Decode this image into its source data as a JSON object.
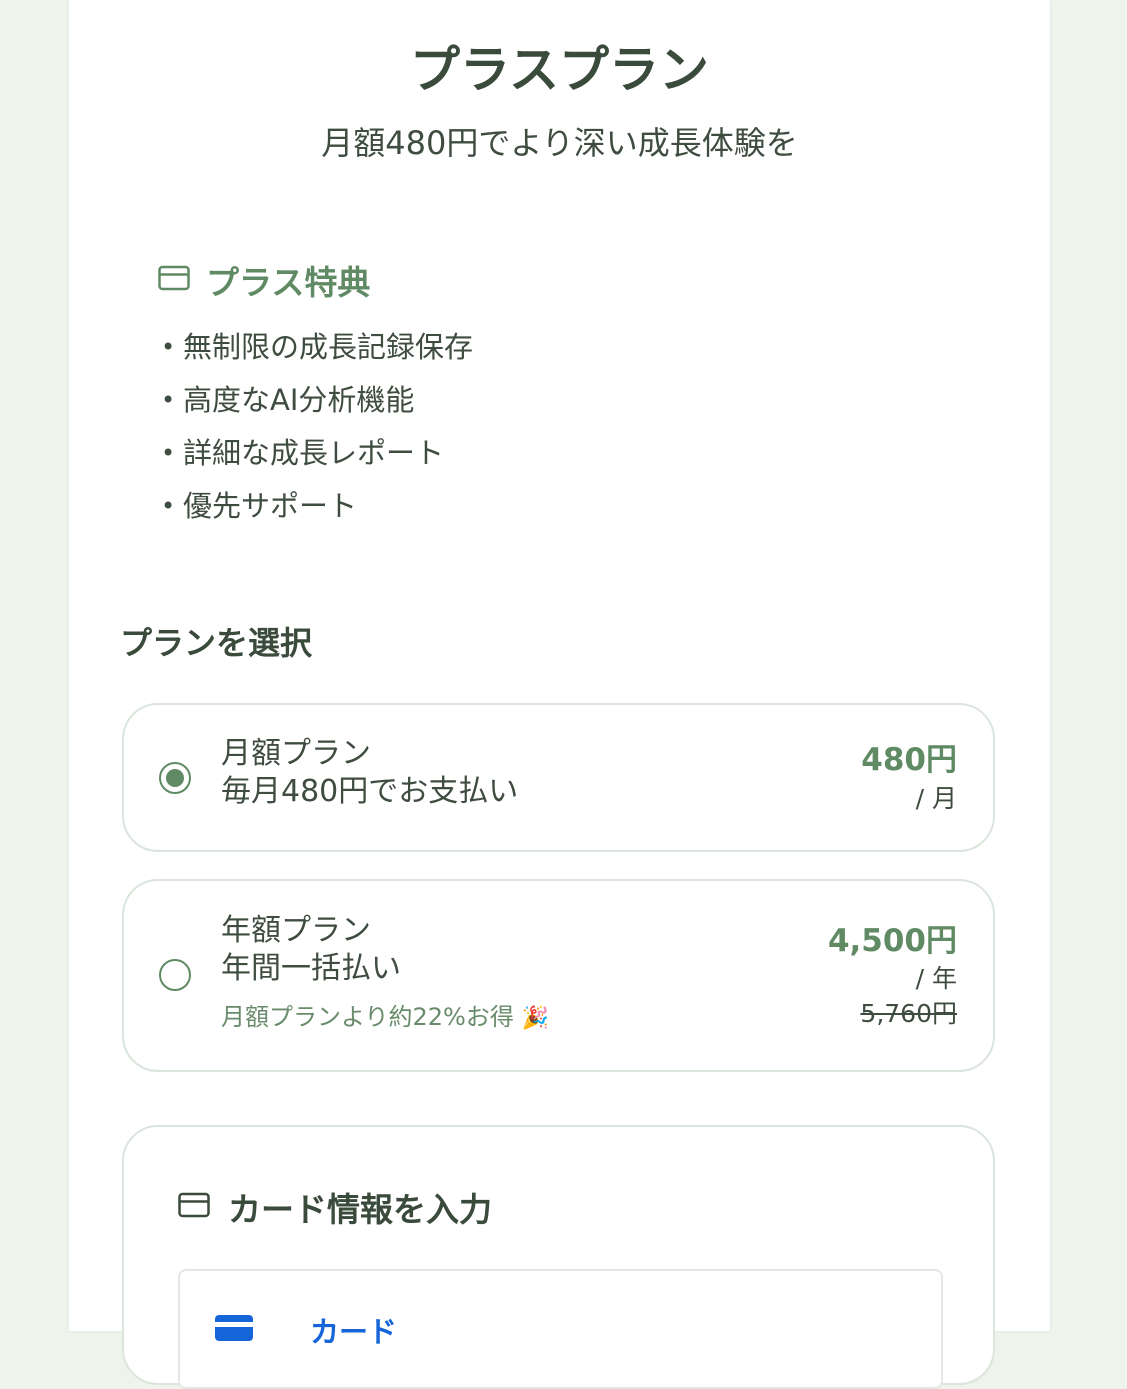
{
  "header": {
    "title": "プラスプラン",
    "subtitle": "月額480円でより深い成長体験を"
  },
  "benefits": {
    "title": "プラス特典",
    "icon": "card-icon",
    "items": [
      "無制限の成長記録保存",
      "高度なAI分析機能",
      "詳細な成長レポート",
      "優先サポート"
    ]
  },
  "plan_select": {
    "title": "プランを選択",
    "monthly": {
      "selected": true,
      "name": "月額プラン",
      "description": "毎月480円でお支払い",
      "price": "480円",
      "per": "/ 月"
    },
    "yearly": {
      "selected": false,
      "name": "年額プラン",
      "description": "年間一括払い",
      "savings": "月額プランより約22%お得",
      "savings_emoji": "🎉",
      "price": "4,500円",
      "per": "/ 年",
      "original_price": "5,760円"
    }
  },
  "card_form": {
    "title": "カード情報を入力",
    "icon": "card-icon",
    "method_tab": {
      "icon": "card-icon",
      "label": "カード"
    }
  },
  "colors": {
    "accent": "#5f8a63",
    "text": "#3f4d40",
    "border": "#dbe5dc",
    "background": "#eef4ec",
    "link_blue": "#1565d8"
  }
}
